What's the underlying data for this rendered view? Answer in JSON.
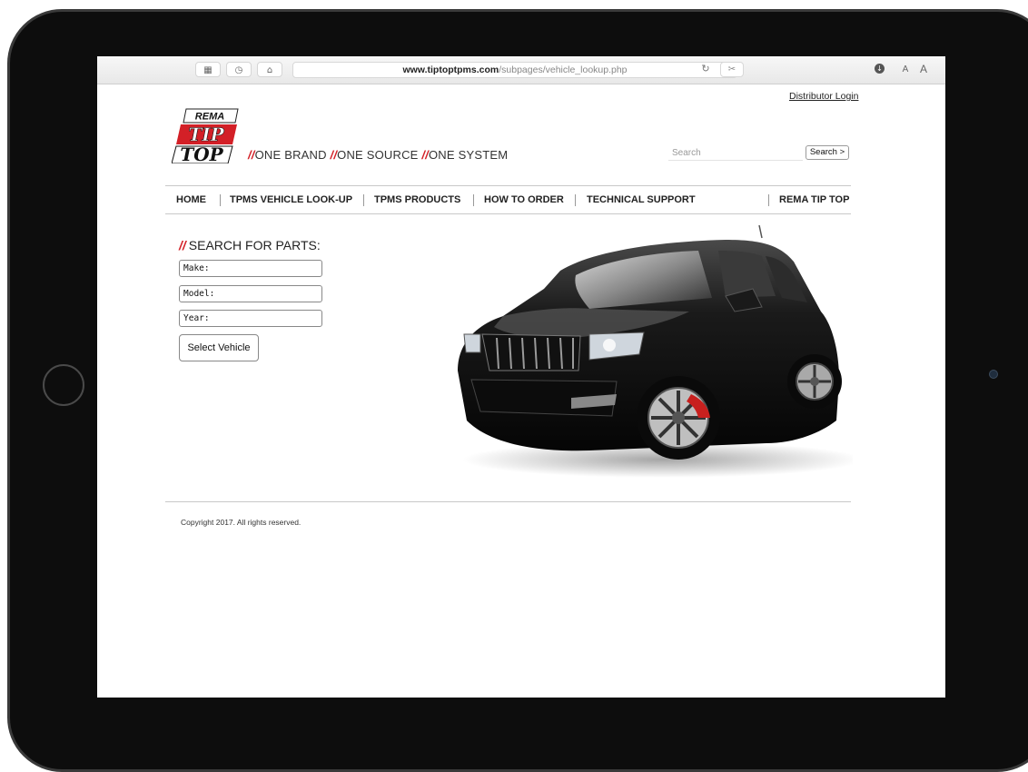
{
  "browser": {
    "url_host": "www.tiptoptpms.com",
    "url_path": "/subpages/vehicle_lookup.php",
    "toolbar_icons": [
      "sidebar-icon",
      "history-icon",
      "home-icon",
      "reload-icon",
      "reader-icon",
      "download-icon"
    ],
    "text_size_small": "A",
    "text_size_large": "A"
  },
  "header": {
    "distributor_login": "Distributor Login",
    "logo_text": [
      "REMA",
      "TIP",
      "TOP"
    ],
    "tagline": [
      {
        "slash": "//",
        "text": "ONE BRAND "
      },
      {
        "slash": "//",
        "text": "ONE SOURCE "
      },
      {
        "slash": "//",
        "text": "ONE SYSTEM"
      }
    ],
    "search_placeholder": "Search",
    "search_button": "Search >"
  },
  "nav": {
    "items": [
      "HOME",
      "TPMS VEHICLE LOOK-UP",
      "TPMS PRODUCTS",
      "HOW TO ORDER",
      "TECHNICAL SUPPORT",
      "REMA TIP TOP"
    ]
  },
  "search_panel": {
    "slash": "//",
    "title": "SEARCH FOR PARTS:",
    "make_placeholder": "Make:",
    "model_placeholder": "Model:",
    "year_placeholder": "Year:",
    "select_button": "Select Vehicle"
  },
  "footer": {
    "copyright": "Copyright 2017. All rights reserved."
  },
  "colors": {
    "brand_red": "#d32027",
    "ipad_frame": "#0d0d0d",
    "toolbar_bg": "#ececec"
  }
}
